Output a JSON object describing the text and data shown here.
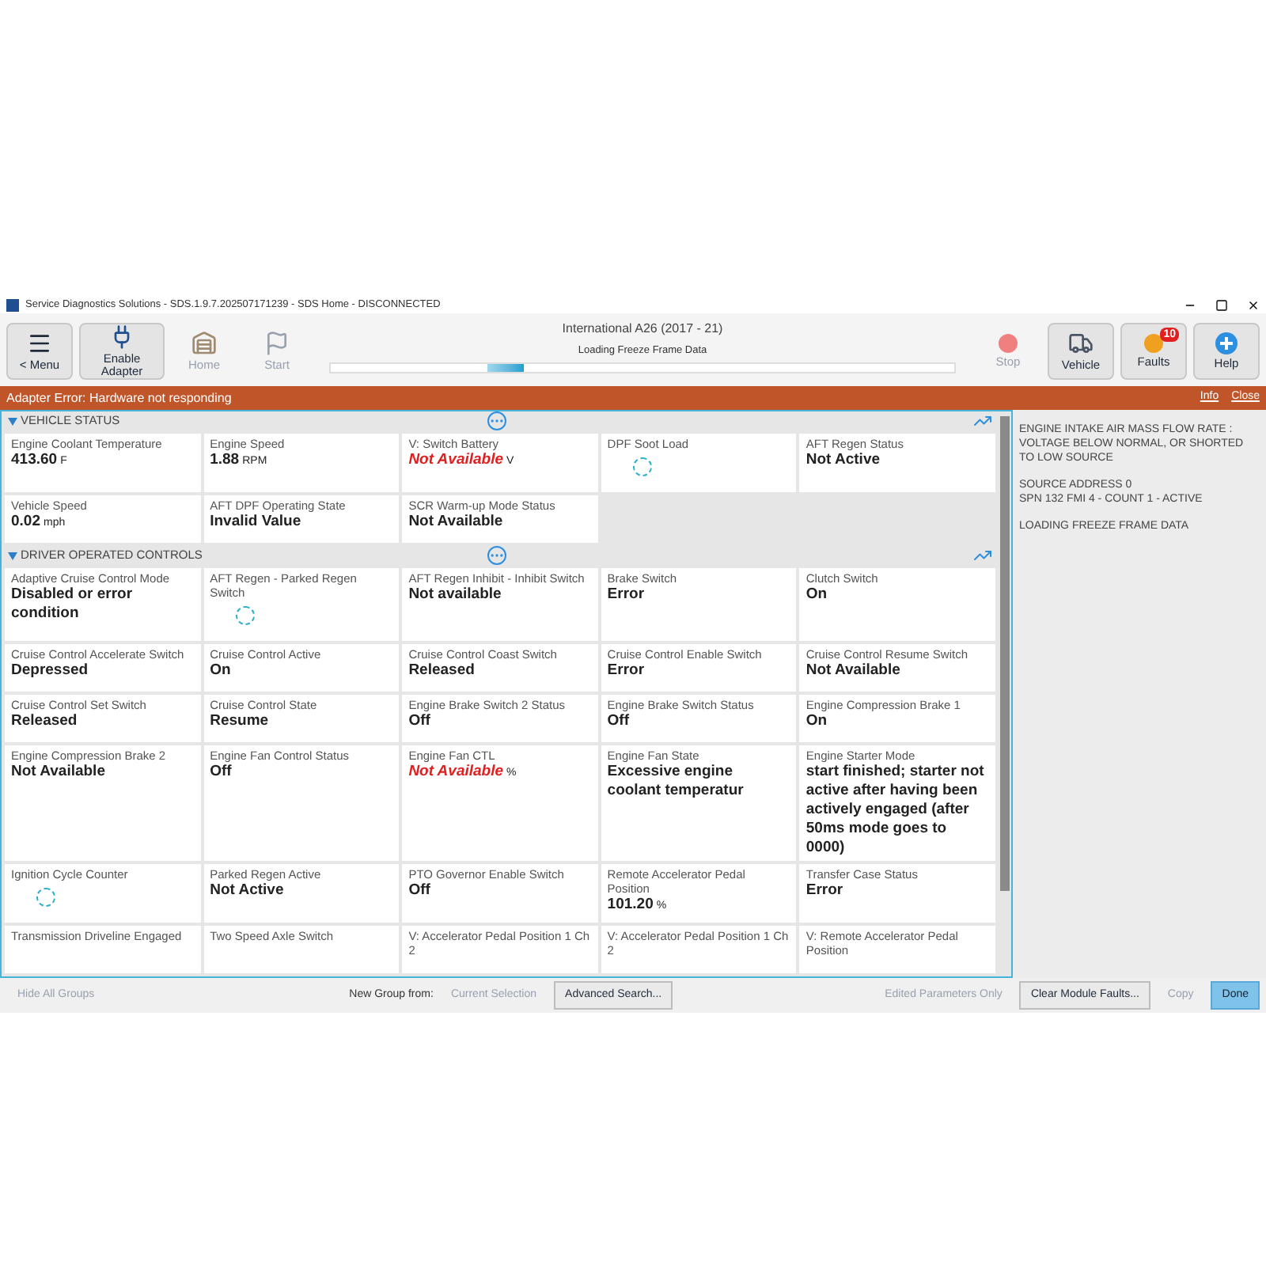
{
  "window": {
    "title": "Service Diagnostics Solutions - SDS.1.9.7.202507171239 - SDS Home - DISCONNECTED"
  },
  "vehicle_title": "International A26 (2017 - 21)",
  "toolbar_left": [
    {
      "kind": "menu",
      "label": "< Menu",
      "disabled": false
    },
    {
      "kind": "adapter",
      "label": "Enable Adapter",
      "disabled": false
    },
    {
      "kind": "home",
      "label": "Home",
      "disabled": true
    },
    {
      "kind": "start",
      "label": "Start",
      "disabled": true
    }
  ],
  "loading": {
    "label": "Loading Freeze Frame Data",
    "level": 0.31
  },
  "toolbar_right": [
    {
      "kind": "stop",
      "label": "Stop",
      "disabled": true
    },
    {
      "kind": "vehicle",
      "label": "Vehicle",
      "disabled": false
    },
    {
      "kind": "faults",
      "label": "Faults",
      "disabled": false,
      "badge": "10"
    },
    {
      "kind": "help",
      "label": "Help",
      "disabled": false
    }
  ],
  "error_bar": {
    "message": "Adapter Error: Hardware not responding",
    "links": [
      "Info",
      "Close"
    ]
  },
  "groups": [
    {
      "title": "VEHICLE STATUS",
      "expanded": true,
      "cells": [
        {
          "kind": "value",
          "label": "Engine Coolant Temperature",
          "value": "413.60",
          "unit": "F"
        },
        {
          "kind": "value",
          "label": "Engine Speed",
          "value": "1.88",
          "unit": "RPM"
        },
        {
          "kind": "error",
          "label": "V: Switch Battery",
          "value": "Not Available",
          "unit": "V"
        },
        {
          "kind": "loading",
          "label": "DPF Soot Load"
        },
        {
          "kind": "value",
          "label": "AFT Regen Status",
          "value": "Not Active"
        },
        {
          "kind": "value",
          "label": "Vehicle Speed",
          "value": "0.02",
          "unit": "mph"
        },
        {
          "kind": "value",
          "label": "AFT DPF Operating State",
          "value": "Invalid Value"
        },
        {
          "kind": "value",
          "label": "SCR Warm-up Mode Status",
          "value": "Not Available"
        }
      ]
    },
    {
      "title": "DRIVER OPERATED CONTROLS",
      "expanded": true,
      "cells": [
        {
          "kind": "value",
          "label": "Adaptive Cruise Control Mode",
          "value": "Disabled or error condition"
        },
        {
          "kind": "loading",
          "label": "AFT Regen - Parked Regen Switch"
        },
        {
          "kind": "value",
          "label": "AFT Regen Inhibit - Inhibit Switch",
          "value": "Not available"
        },
        {
          "kind": "value",
          "label": "Brake Switch",
          "value": "Error"
        },
        {
          "kind": "value",
          "label": "Clutch Switch",
          "value": "On"
        },
        {
          "kind": "value",
          "label": "Cruise Control Accelerate Switch",
          "value": "Depressed"
        },
        {
          "kind": "value",
          "label": "Cruise Control Active",
          "value": "On"
        },
        {
          "kind": "value",
          "label": "Cruise Control Coast Switch",
          "value": "Released"
        },
        {
          "kind": "value",
          "label": "Cruise Control Enable Switch",
          "value": "Error"
        },
        {
          "kind": "value",
          "label": "Cruise Control Resume Switch",
          "value": "Not Available"
        },
        {
          "kind": "value",
          "label": "Cruise Control Set Switch",
          "value": "Released"
        },
        {
          "kind": "value",
          "label": "Cruise Control State",
          "value": "Resume"
        },
        {
          "kind": "value",
          "label": "Engine Brake Switch 2 Status",
          "value": "Off"
        },
        {
          "kind": "value",
          "label": "Engine Brake Switch Status",
          "value": "Off"
        },
        {
          "kind": "value",
          "label": "Engine Compression Brake 1",
          "value": "On"
        },
        {
          "kind": "value",
          "label": "Engine Compression Brake 2",
          "value": "Not Available"
        },
        {
          "kind": "value",
          "label": "Engine Fan Control Status",
          "value": "Off"
        },
        {
          "kind": "error",
          "label": "Engine Fan CTL",
          "value": "Not Available",
          "unit": "%"
        },
        {
          "kind": "value",
          "label": "Engine Fan State",
          "value": "Excessive engine coolant temperatur"
        },
        {
          "kind": "value",
          "label": "Engine Starter Mode",
          "value": "start finished; starter not active after having been actively engaged (after 50ms mode goes to 0000)"
        },
        {
          "kind": "loading",
          "label": "Ignition Cycle Counter"
        },
        {
          "kind": "value",
          "label": "Parked Regen Active",
          "value": "Not Active"
        },
        {
          "kind": "value",
          "label": "PTO Governor Enable Switch",
          "value": "Off"
        },
        {
          "kind": "value",
          "label": "Remote Accelerator Pedal Position",
          "value": "101.20",
          "unit": "%"
        },
        {
          "kind": "value",
          "label": "Transfer Case Status",
          "value": "Error"
        },
        {
          "kind": "label",
          "label": "Transmission Driveline Engaged"
        },
        {
          "kind": "label",
          "label": "Two Speed Axle Switch"
        },
        {
          "kind": "label",
          "label": "V: Accelerator Pedal Position 1 Ch 2"
        },
        {
          "kind": "label",
          "label": "V: Accelerator Pedal Position 1 Ch 2"
        },
        {
          "kind": "label",
          "label": "V: Remote Accelerator Pedal Position"
        }
      ]
    }
  ],
  "fault_panel": [
    "ENGINE INTAKE AIR MASS FLOW RATE : VOLTAGE BELOW NORMAL, OR SHORTED TO LOW SOURCE",
    "SOURCE ADDRESS 0\nSPN 132 FMI 4 - COUNT 1 - ACTIVE",
    "LOADING FREEZE FRAME DATA"
  ],
  "bottom_bar": {
    "left": [
      {
        "label": "Hide All Groups",
        "disabled": true
      }
    ],
    "group_label": "New Group from:",
    "middle": [
      {
        "label": "Current Selection",
        "disabled": true
      },
      {
        "label": "Advanced Search...",
        "disabled": false
      }
    ],
    "right": [
      {
        "label": "Edited Parameters Only",
        "disabled": true
      },
      {
        "label": "Clear Module Faults...",
        "disabled": false
      },
      {
        "label": "Copy",
        "disabled": true
      },
      {
        "label": "Done",
        "disabled": false,
        "primary": true
      }
    ]
  }
}
